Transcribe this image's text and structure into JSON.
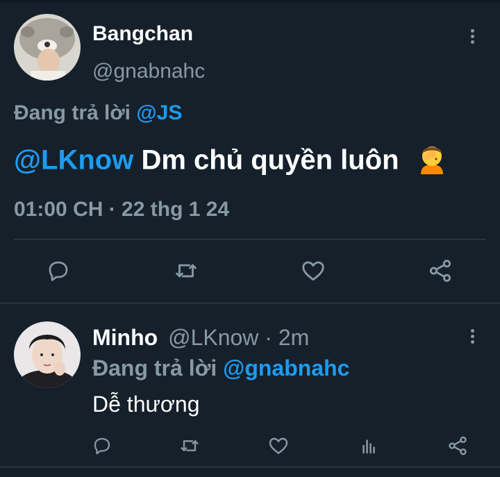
{
  "tweet": {
    "display_name": "Bangchan",
    "handle": "@gnabnahc",
    "replying_prefix": "Đang trả lời",
    "replying_to": "@JS",
    "mention": "@LKnow",
    "text": "Dm chủ quyền luôn",
    "emoji_icon": "person-facepalming-icon",
    "timestamp": "01:00 CH · 22 thg 1 24",
    "actions": [
      "reply-icon",
      "retweet-icon",
      "like-icon",
      "share-icon"
    ]
  },
  "reply": {
    "display_name": "Minho",
    "handle": "@LKnow",
    "separator": "·",
    "time": "2m",
    "replying_prefix": "Đang trả lời",
    "replying_to": "@gnabnahc",
    "text": "Dễ thương",
    "actions": [
      "reply-icon",
      "retweet-icon",
      "like-icon",
      "analytics-icon",
      "share-icon"
    ]
  },
  "colors": {
    "background": "#15202b",
    "link": "#1d9bf0",
    "muted": "#8899a6",
    "divider": "#38444d"
  }
}
